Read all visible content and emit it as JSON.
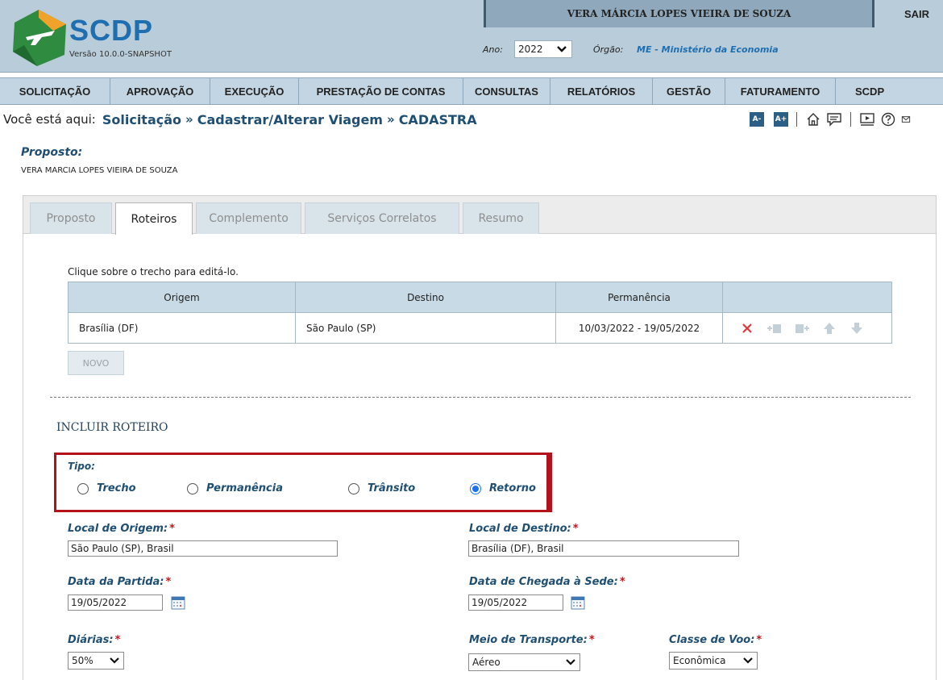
{
  "header": {
    "app_name": "SCDP",
    "version": "Versão 10.0.0-SNAPSHOT",
    "user_name": "VERA MÁRCIA LOPES VIEIRA DE SOUZA",
    "logout": "SAIR",
    "year_label": "Ano:",
    "year_value": "2022",
    "org_label": "Órgão:",
    "org_value": "ME - Ministério da Economia"
  },
  "menu": [
    "SOLICITAÇÃO",
    "APROVAÇÃO",
    "EXECUÇÃO",
    "PRESTAÇÃO DE CONTAS",
    "CONSULTAS",
    "RELATÓRIOS",
    "GESTÃO",
    "FATURAMENTO",
    "SCDP"
  ],
  "breadcrumb": {
    "prefix": "Você está aqui:",
    "parts": [
      "Solicitação",
      "Cadastrar/Alterar Viagem",
      "CADASTRA"
    ]
  },
  "toolbar": {
    "font_decrease": "A-",
    "font_increase": "A+"
  },
  "proposto": {
    "title": "Proposto:",
    "name": "VERA MARCIA LOPES VIEIRA DE SOUZA"
  },
  "tabs": [
    "Proposto",
    "Roteiros",
    "Complemento",
    "Serviços Correlatos",
    "Resumo"
  ],
  "active_tab": "Roteiros",
  "route_table": {
    "hint": "Clique sobre o trecho para editá-lo.",
    "headers": [
      "Origem",
      "Destino",
      "Permanência"
    ],
    "rows": [
      {
        "origem": "Brasília (DF)",
        "destino": "São Paulo (SP)",
        "permanencia": "10/03/2022 - 19/05/2022"
      }
    ]
  },
  "novo_button": "NOVO",
  "form": {
    "section_title": "INCLUIR ROTEIRO",
    "tipo_label": "Tipo:",
    "tipo_options": [
      "Trecho",
      "Permanência",
      "Trânsito",
      "Retorno"
    ],
    "tipo_selected": "Retorno",
    "origem_label": "Local de Origem:",
    "origem_value": "São Paulo (SP), Brasil",
    "destino_label": "Local de Destino:",
    "destino_value": "Brasília (DF), Brasil",
    "partida_label": "Data da Partida:",
    "partida_value": "19/05/2022",
    "chegada_label": "Data de Chegada à Sede:",
    "chegada_value": "19/05/2022",
    "diarias_label": "Diárias:",
    "diarias_value": "50%",
    "transporte_label": "Meio de Transporte:",
    "transporte_value": "Aéreo",
    "classe_label": "Classe de Voo:",
    "classe_value": "Econômica",
    "required_mark": "*"
  },
  "colors": {
    "header_bg": "#b9ccd9",
    "menu_bg": "#c3d5e2",
    "brand_blue": "#1e6eb0",
    "label_blue": "#1f4f73",
    "highlight_red": "#b3121a",
    "logo_green": "#2e8b3f"
  }
}
